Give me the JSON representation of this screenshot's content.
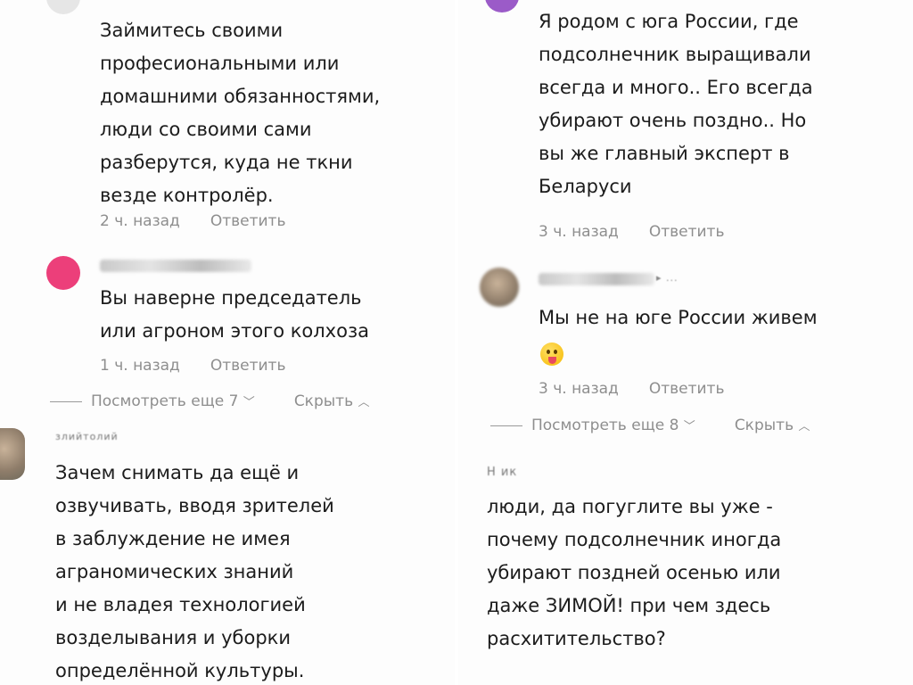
{
  "left": {
    "c1": {
      "text": "Займитесь своими\nпрофесиональными или\nдомашними обязанностями,\nлюди со своими сами\nразберутся, куда не ткни\nвезде контролёр.",
      "time": "2 ч. назад",
      "reply": "Ответить"
    },
    "c2": {
      "author": "Г        ИРАМЕС1",
      "text": "Вы наверне председатель\nили агроном этого колхоза",
      "time": "1 ч. назад",
      "reply": "Ответить",
      "avatar_color": "#ec3f7a"
    },
    "thread": {
      "more": "Посмотреть еще 7",
      "hide": "Скрыть"
    },
    "c3": {
      "author": "злийтолий",
      "text": "Зачем снимать да ещё и\nозвучивать, вводя зрителей\nв заблуждение не имея\nаграномических знаний\nи не владея технологией\nвозделывания и уборки\nопределённой культуры."
    }
  },
  "right": {
    "c1": {
      "text": "Я родом с юга России, где\nподсолнечник выращивали\nвсегда и много.. Его всегда\nубирают очень поздно.. Но\nвы же главный эксперт в\nБеларуси",
      "time": "3 ч. назад",
      "reply": "Ответить",
      "avatar_color": "#9b5bc8"
    },
    "c2": {
      "author_suffix": "▸ ...",
      "text": "Мы не на юге России живем",
      "time": "3 ч. назад",
      "reply": "Ответить"
    },
    "thread": {
      "more": "Посмотреть еще 8",
      "hide": "Скрыть"
    },
    "c3": {
      "author": "Н          ик",
      "text": "люди, да погуглите вы уже -\nпочему подсолнечник иногда\nубирают поздней осенью или\nдаже ЗИМОЙ! при чем здесь\nрасхитительство?"
    }
  },
  "icons": {
    "chevron_down": "﹀",
    "chevron_up": "︿"
  }
}
